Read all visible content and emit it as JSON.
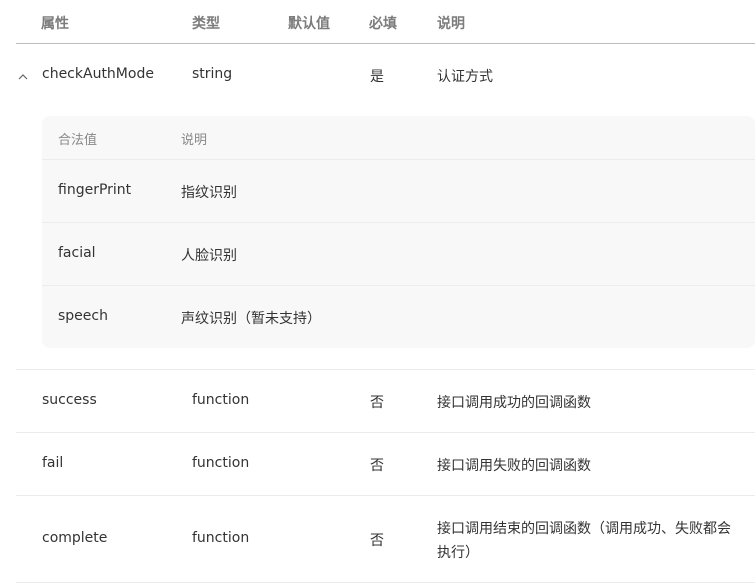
{
  "header": {
    "property": "属性",
    "type": "类型",
    "default": "默认值",
    "required": "必填",
    "description": "说明"
  },
  "rows": [
    {
      "name": "checkAuthMode",
      "type": "string",
      "default": "",
      "required": "是",
      "description": "认证方式",
      "expanded": true,
      "sub": {
        "header": {
          "value": "合法值",
          "description": "说明"
        },
        "items": [
          {
            "value": "fingerPrint",
            "description": "指纹识别"
          },
          {
            "value": "facial",
            "description": "人脸识别"
          },
          {
            "value": "speech",
            "description": "声纹识别（暂未支持）"
          }
        ]
      }
    },
    {
      "name": "success",
      "type": "function",
      "default": "",
      "required": "否",
      "description": "接口调用成功的回调函数"
    },
    {
      "name": "fail",
      "type": "function",
      "default": "",
      "required": "否",
      "description": "接口调用失败的回调函数"
    },
    {
      "name": "complete",
      "type": "function",
      "default": "",
      "required": "否",
      "description_line1": "接口调用结束的回调函数（调用成功、失败都会",
      "description_line2": "执行）"
    }
  ],
  "icons": {
    "collapse": "chevron-up-icon"
  }
}
